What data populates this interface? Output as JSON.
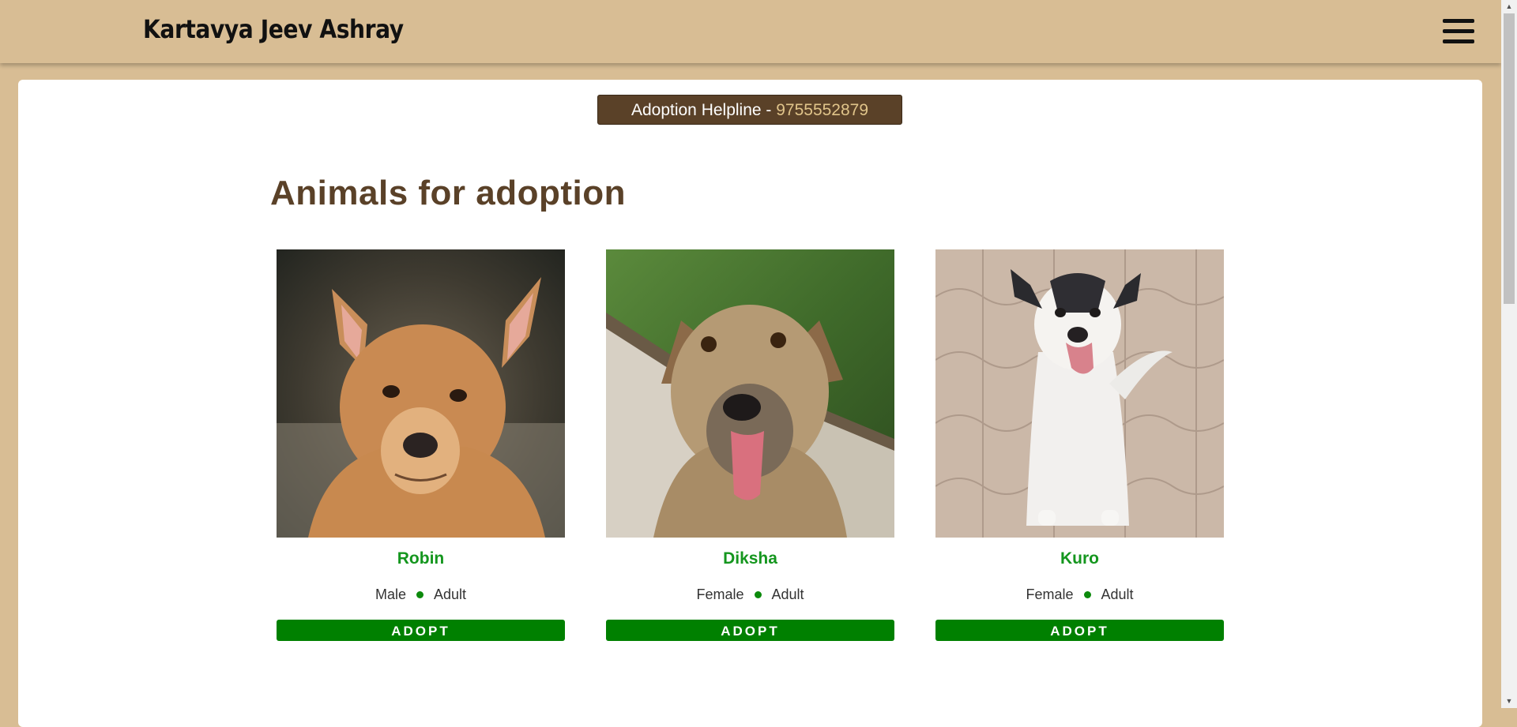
{
  "header": {
    "brand": "Kartavya Jeev Ashray",
    "menu_icon": "hamburger-menu-icon"
  },
  "helpline": {
    "label": "Adoption Helpline - ",
    "number": "9755552879"
  },
  "main": {
    "heading": "Animals for adoption"
  },
  "animals": [
    {
      "name": "Robin",
      "gender": "Male",
      "age": "Adult",
      "button": "ADOPT"
    },
    {
      "name": "Diksha",
      "gender": "Female",
      "age": "Adult",
      "button": "ADOPT"
    },
    {
      "name": "Kuro",
      "gender": "Female",
      "age": "Adult",
      "button": "ADOPT"
    }
  ],
  "colors": {
    "header_bg": "#d8bd94",
    "helpline_bg": "#5a4128",
    "heading": "#5a4128",
    "name": "#14961e",
    "adopt_button": "#008000"
  }
}
